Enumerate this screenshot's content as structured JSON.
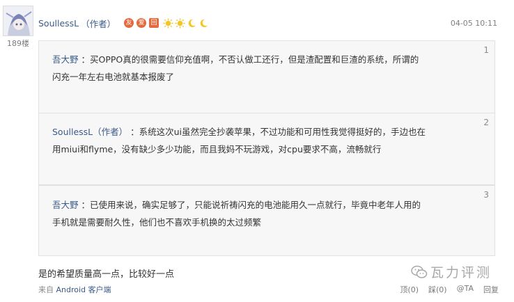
{
  "floor": "189楼",
  "author": {
    "name": "SoullessL",
    "tag": "（作者）"
  },
  "badges": [
    "友",
    "爱",
    "回"
  ],
  "date": "04-05 10:11",
  "quotes": [
    {
      "index": "1",
      "name": "吾大野",
      "separator": " ：",
      "line1": "买OPPO真的很需要信仰充值啊，不否认做工还行，但是渣配置和巨渣的系统，所谓的",
      "line2": "闪充一年左右电池就基本报废了"
    },
    {
      "index": "2",
      "name": "SoullessL（作者）",
      "separator": " ：",
      "line1": "系统这次ui虽然完全抄袭苹果，不过功能和可用性我觉得挺好的，手边也在",
      "line2": "用miui和flyme，没有缺少多少功能，而且我妈不玩游戏，对cpu要求不高，流畅就行"
    },
    {
      "index": "3",
      "name": "吾大野",
      "separator": " ：",
      "line1": "已使用来说，确实足够了，只能说祈祷闪充的电池能用久一点就行，毕竟中老年人用的",
      "line2": "手机就是需要耐久性，他们也不喜欢手机换的太过频繁"
    }
  ],
  "main_text": "是的希望质量高一点，比较好一点",
  "source": {
    "prefix": "来自 ",
    "link": "Android 客户端"
  },
  "actions": {
    "up": "顶(0)",
    "down": "踩(0)",
    "at": "@TA",
    "reply": "回复"
  },
  "watermark": "瓦力评测",
  "colors": {
    "link": "#3b5b8a",
    "badge": "#e46a3d",
    "quote_bg": "#f7f7f7",
    "level_sun": "#f3c623"
  }
}
